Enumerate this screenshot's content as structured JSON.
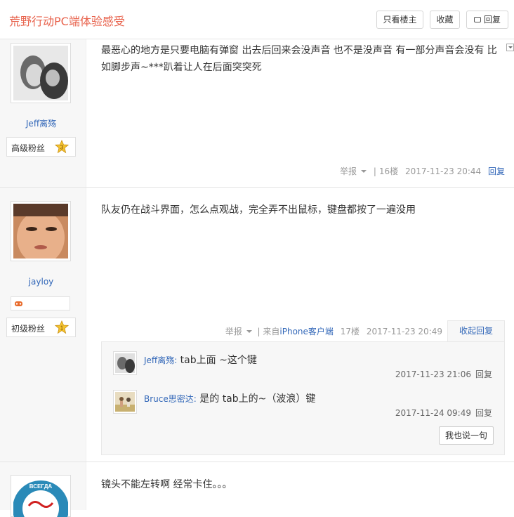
{
  "header": {
    "title": "荒野行动PC端体验感受",
    "only_op_label": "只看楼主",
    "favorite_label": "收藏",
    "reply_label": "回复"
  },
  "posts": [
    {
      "username": "Jeff离殇",
      "level_name": "高级粉丝",
      "level_number": "3",
      "content": [
        "最恶心的地方是只要电脑有弹窗 出去后回来会没声音 也不是没声音 有一部分声音会没有 比",
        "如脚步声~***趴着让人在后面突突死"
      ],
      "report_label": "举报",
      "floor": "16楼",
      "time": "2017-11-23 20:44",
      "reply_label": "回复"
    },
    {
      "username": "jayloy",
      "level_name": "初级粉丝",
      "level_number": "1",
      "content": [
        "队友仍在战斗界面，怎么点观战，完全弄不出鼠标，键盘都按了一遍没用"
      ],
      "report_label": "举报",
      "source_prefix": "| 来自",
      "source": "iPhone客户端",
      "floor": "17楼",
      "time": "2017-11-23 20:49",
      "collapse_label": "收起回复",
      "subcomments": [
        {
          "user": "Jeff离殇:",
          "text": " tab上面 ~这个键",
          "time": "2017-11-23 21:06",
          "reply": "回复"
        },
        {
          "user": "Bruce思密达:",
          "text": " 是的 tab上的~（波浪）键",
          "time": "2017-11-24 09:49",
          "reply": "回复"
        }
      ],
      "say_label": "我也说一句"
    },
    {
      "content": [
        "镜头不能左转啊 经常卡住。。。"
      ],
      "avatar_text": "ВСЕГДА"
    }
  ],
  "colors": {
    "title": "#e8624c",
    "link": "#3267b8",
    "star": "#f4c430"
  }
}
